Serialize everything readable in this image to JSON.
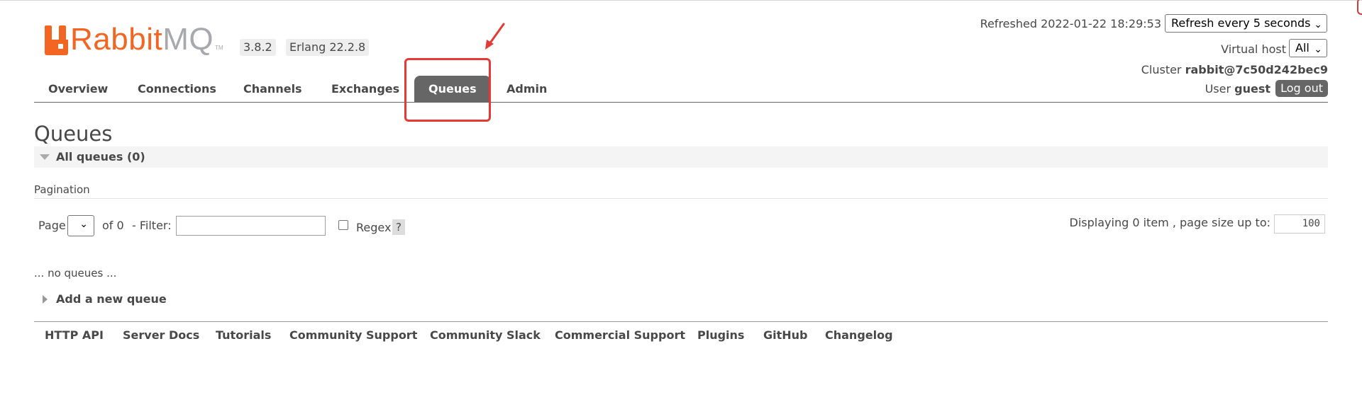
{
  "logo": {
    "part1": "Rabbit",
    "part2": "MQ",
    "tm": "TM"
  },
  "versions": {
    "rabbitmq": "3.8.2",
    "erlang": "Erlang 22.2.8"
  },
  "header": {
    "refreshed_label": "Refreshed 2022-01-22 18:29:53",
    "refresh_select": "Refresh every 5 seconds",
    "vhost_label": "Virtual host",
    "vhost_select": "All",
    "cluster_label": "Cluster",
    "cluster_name": "rabbit@7c50d242bec9",
    "user_label": "User",
    "user_name": "guest",
    "logout": "Log out"
  },
  "nav": {
    "tabs": [
      "Overview",
      "Connections",
      "Channels",
      "Exchanges",
      "Queues",
      "Admin"
    ],
    "active": "Queues"
  },
  "main": {
    "title": "Queues",
    "section": "All queues (0)",
    "pagination_label": "Pagination",
    "page_label": "Page",
    "of_label": "of 0",
    "filter_label": "- Filter:",
    "filter_value": "",
    "regex_label": "Regex",
    "help": "?",
    "display_text": "Displaying 0 item , page size up to:",
    "page_size": "100",
    "empty_text": "... no queues ...",
    "add_queue": "Add a new queue"
  },
  "footer": {
    "links": [
      "HTTP API",
      "Server Docs",
      "Tutorials",
      "Community Support",
      "Community Slack",
      "Commercial Support",
      "Plugins",
      "GitHub",
      "Changelog"
    ]
  },
  "colors": {
    "brand_orange": "#f26522",
    "brand_gray": "#a7a9ac",
    "nav_active": "#666666",
    "annotation": "#e53935"
  }
}
